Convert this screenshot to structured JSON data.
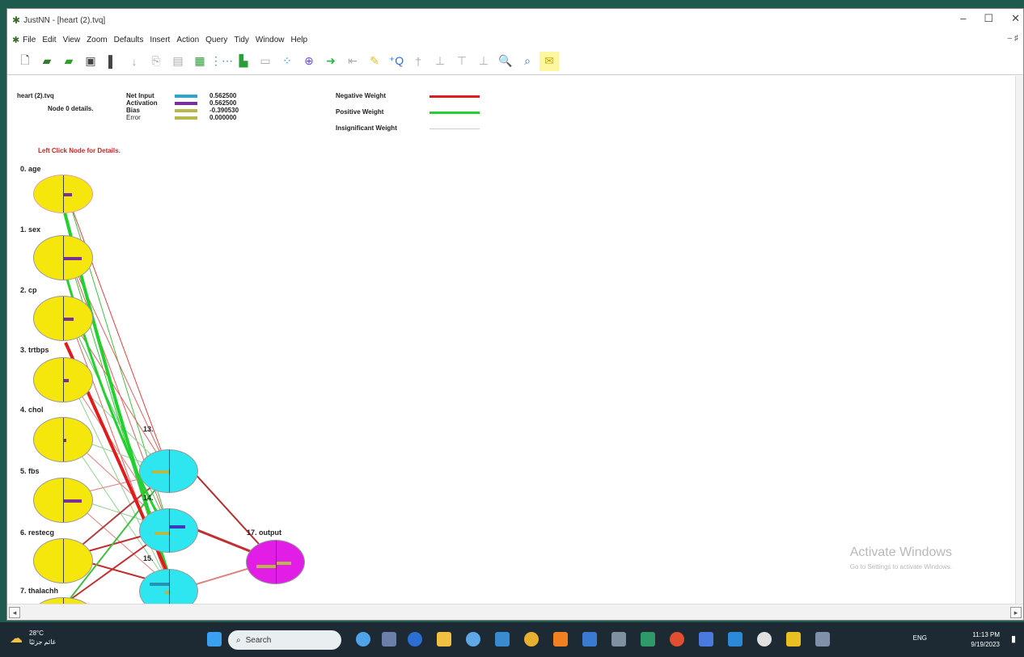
{
  "window": {
    "title": "JustNN - [heart (2).tvq]",
    "controls": [
      "–",
      "☐",
      "✕"
    ]
  },
  "menu": {
    "items": [
      "File",
      "Edit",
      "View",
      "Zoom",
      "Defaults",
      "Insert",
      "Action",
      "Query",
      "Tidy",
      "Window",
      "Help"
    ],
    "mdi_controls": "– ♯"
  },
  "toolbar": {
    "buttons": [
      "new",
      "open",
      "open-green",
      "save",
      "separator",
      "undo",
      "copy",
      "paste",
      "grid",
      "net",
      "learn",
      "chart",
      "run",
      "query",
      "go",
      "back",
      "prune",
      "add-query",
      "tidy1",
      "tidy2",
      "tidy3",
      "tidy4",
      "zoom-in",
      "zoom-tool",
      "mail"
    ]
  },
  "info": {
    "filename": "heart (2).tvq",
    "node_details": "Node 0 details.",
    "legend": [
      {
        "label": "Net Input",
        "value": "0.562500",
        "color": "#2aa6c9"
      },
      {
        "label": "Activation",
        "value": "0.562500",
        "color": "#7a2f9a"
      },
      {
        "label": "Bias",
        "value": "-0.390530",
        "color": "#b6b84a"
      },
      {
        "label": "Error",
        "value": "0.000000",
        "color": "#b6b84a"
      }
    ],
    "weights": [
      {
        "label": "Negative Weight",
        "color": "#e01b1b"
      },
      {
        "label": "Positive Weight",
        "color": "#22d12e"
      },
      {
        "label": "Insignificant Weight",
        "color": "#cccccc"
      }
    ],
    "hint": "Left Click Node for Details."
  },
  "nodes": {
    "inputs": [
      "0. age",
      "1. sex",
      "2. cp",
      "3. trtbps",
      "4. chol",
      "5. fbs",
      "6. restecg",
      "7. thalachh"
    ],
    "hidden_labels": [
      "13.",
      "14.",
      "15."
    ],
    "output": "17. output"
  },
  "watermark": {
    "title": "Activate Windows",
    "subtitle": "Go to Settings to activate Windows."
  },
  "taskbar": {
    "temp": "28°C",
    "weather_sub": "غائم جزئيًا",
    "search": "Search",
    "tray": "ENG",
    "time": "11:13 PM",
    "date": "9/19/2023"
  }
}
